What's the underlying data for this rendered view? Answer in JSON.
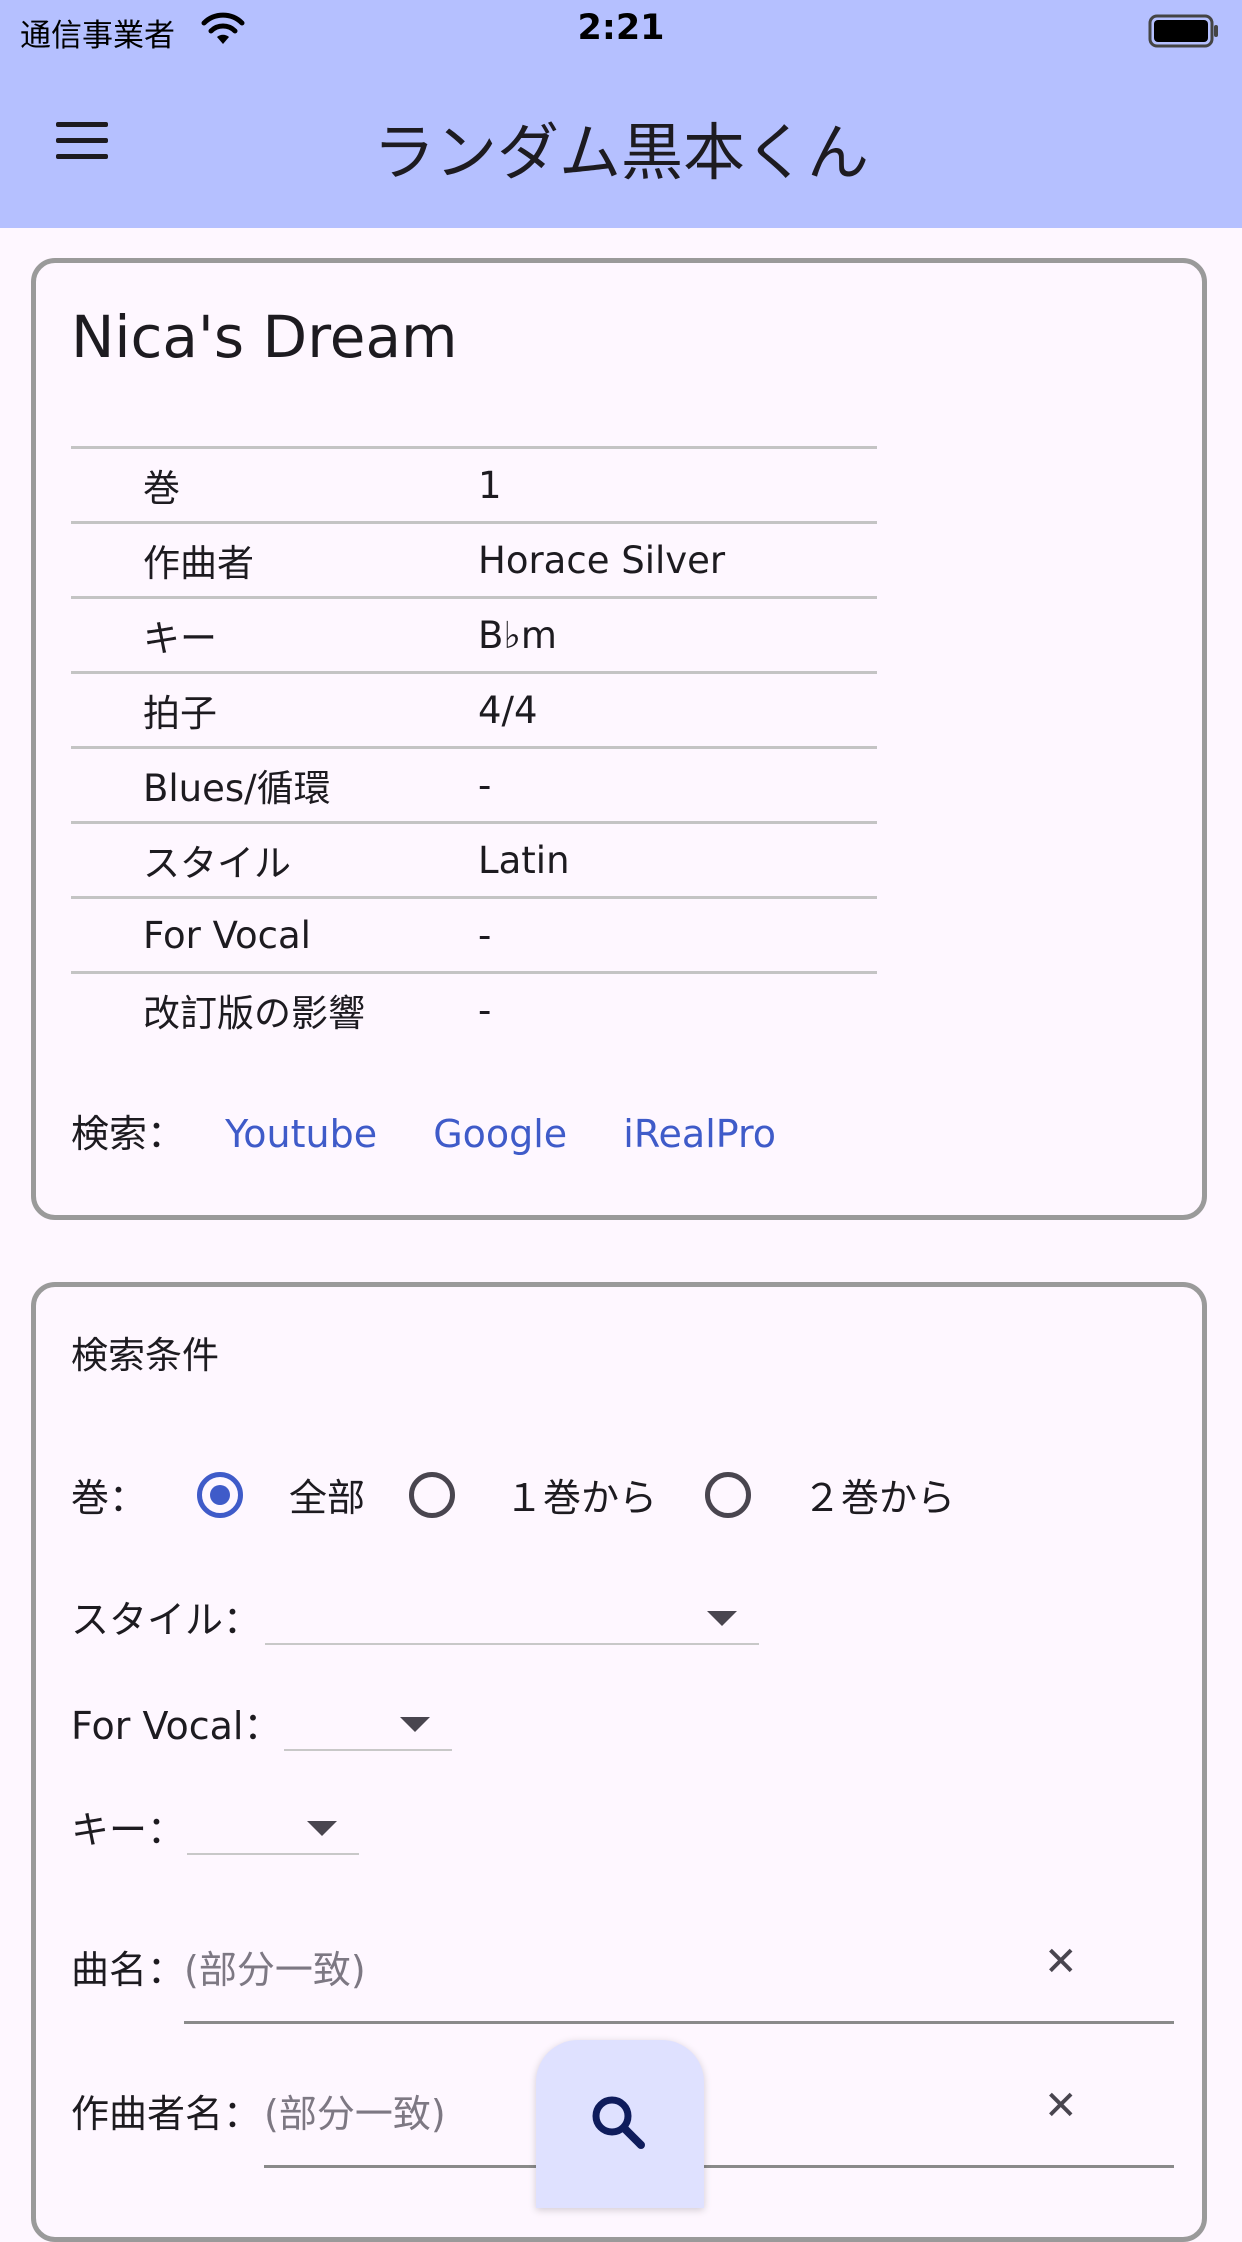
{
  "status_bar": {
    "carrier": "通信事業者",
    "time": "2:21"
  },
  "app_bar": {
    "title": "ランダム黒本くん"
  },
  "song": {
    "title": "Nica's Dream",
    "rows": [
      {
        "key": "巻",
        "value": "1"
      },
      {
        "key": "作曲者",
        "value": "Horace Silver"
      },
      {
        "key": "キー",
        "value": "B♭m"
      },
      {
        "key": "拍子",
        "value": "4/4"
      },
      {
        "key": "Blues/循環",
        "value": "-"
      },
      {
        "key": "スタイル",
        "value": "Latin"
      },
      {
        "key": "For Vocal",
        "value": "-"
      },
      {
        "key": "改訂版の影響",
        "value": "-"
      }
    ],
    "search_label": "検索：",
    "links": [
      "Youtube",
      "Google",
      "iRealPro"
    ]
  },
  "conditions": {
    "title": "検索条件",
    "volume_label": "巻：",
    "volume_options": [
      "全部",
      "１巻から",
      "２巻から"
    ],
    "volume_selected": "全部",
    "style_label": "スタイル：",
    "vocal_label": "For Vocal：",
    "key_label": "キー：",
    "song_name_label": "曲名：",
    "song_name_placeholder": "(部分一致)",
    "composer_label": "作曲者名：",
    "composer_placeholder": "(部分一致)"
  },
  "colors": {
    "app_bar": "#b5c0ff",
    "link": "#3f5bc9",
    "fab": "#dfe1ff"
  },
  "icons": {
    "menu": "hamburger-icon",
    "fab": "search-icon",
    "clear": "close-icon"
  }
}
